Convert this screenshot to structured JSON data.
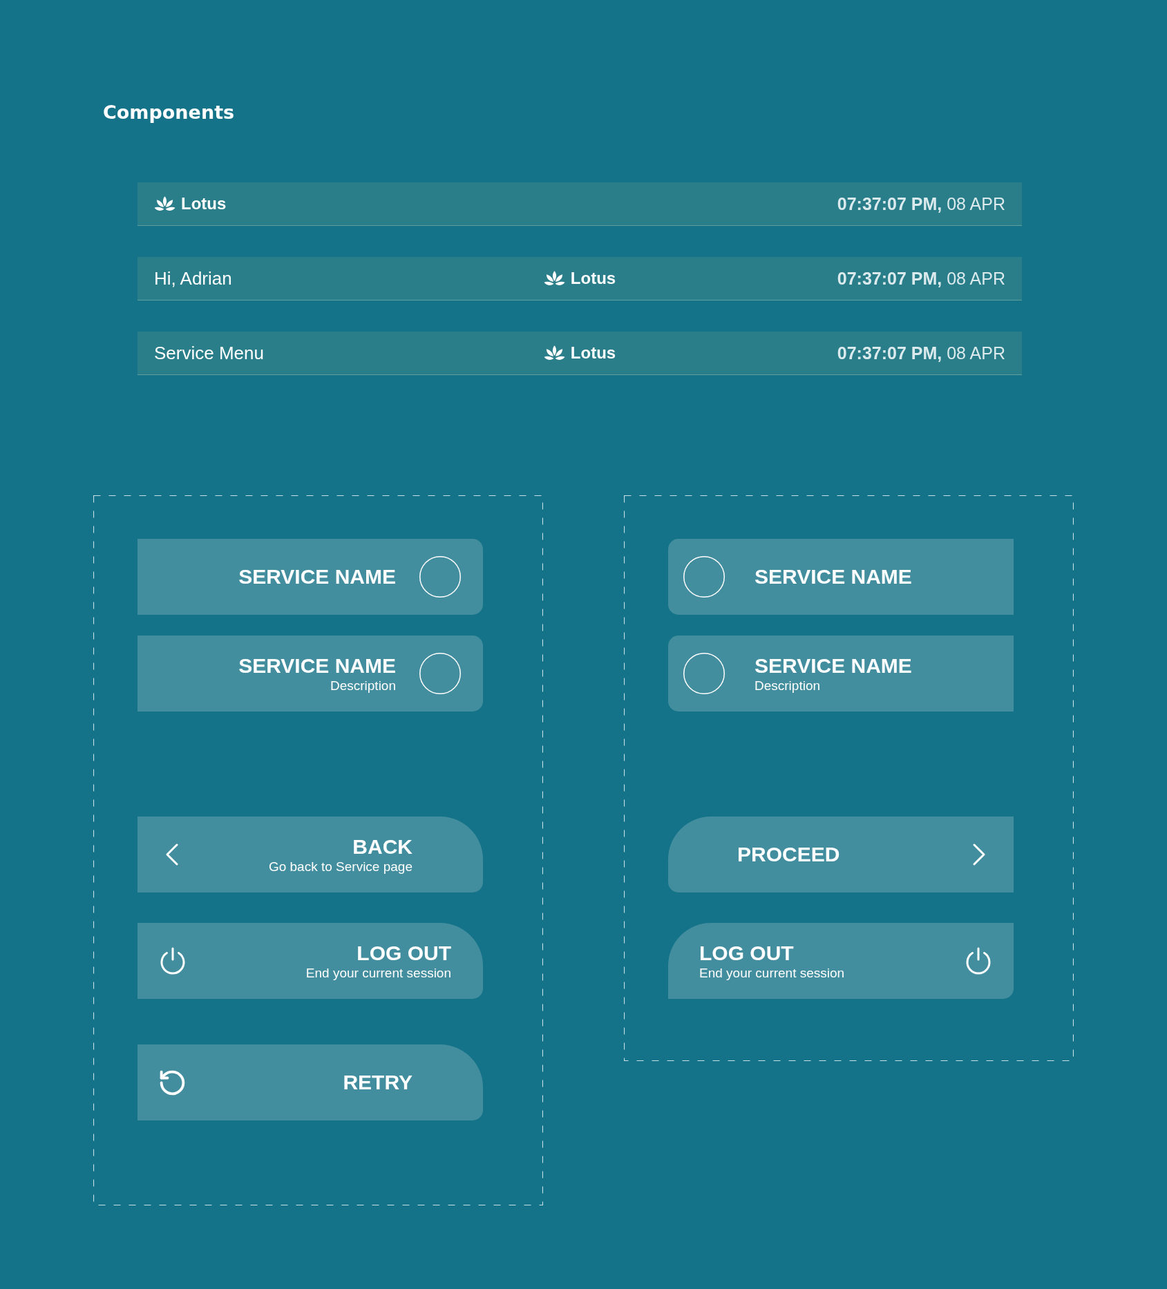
{
  "page": {
    "title": "Components"
  },
  "header_bars": [
    {
      "kind": "brand_left",
      "brand": "Lotus",
      "datetime": "**07:37:07 PM,** 08 APR"
    },
    {
      "kind": "brand_center",
      "greeting": "Hi, Adrian",
      "brand": "Lotus",
      "datetime": "**07:37:07 PM,** 08 APR"
    },
    {
      "kind": "brand_center",
      "menu_title": "Service Menu",
      "brand": "Lotus",
      "datetime": "**07:37:07 PM,** 08 APR"
    }
  ],
  "panels": [
    {
      "mirrored": false,
      "buttons": [
        {
          "kind": "service",
          "title": "SERVICE NAME"
        },
        {
          "kind": "service",
          "title": "SERVICE NAME",
          "description": "Description"
        },
        {
          "kind": "back",
          "title": "BACK",
          "description": "Go back to Service page"
        },
        {
          "kind": "logout",
          "title": "LOG OUT",
          "description": "End your current session"
        },
        {
          "kind": "retry",
          "title": "RETRY"
        }
      ]
    },
    {
      "mirrored": true,
      "buttons": [
        {
          "kind": "service",
          "title": "SERVICE NAME"
        },
        {
          "kind": "service",
          "title": "SERVICE NAME",
          "description": "Description"
        },
        {
          "kind": "proceed",
          "title": "PROCEED"
        },
        {
          "kind": "logout",
          "title": "LOG OUT",
          "description": "End your current session"
        }
      ]
    }
  ]
}
